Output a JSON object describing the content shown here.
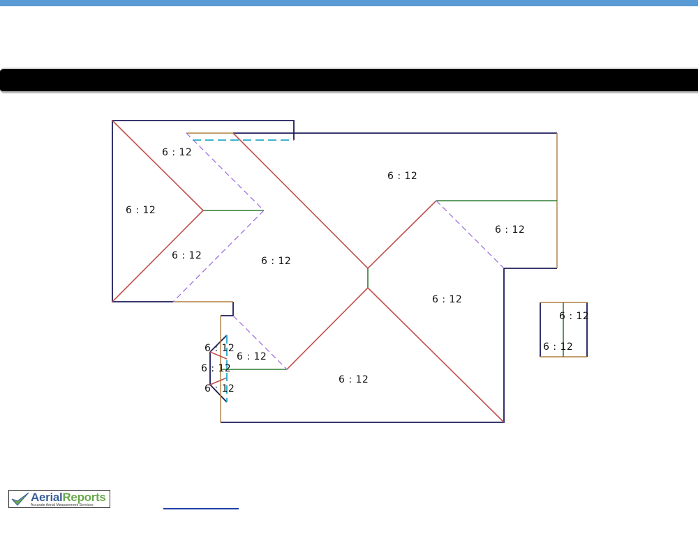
{
  "colors": {
    "top_strip": "#5b9bd5",
    "title_bar": "#000000",
    "eave": "#1c1c5a",
    "rake": "#b08040",
    "hip": "#c0504d",
    "ridge": "#2e7d32",
    "valley": "#9966dd",
    "flashing": "#22aacc"
  },
  "diagram": {
    "pitch_labels": [
      "6 : 12",
      "6 : 12",
      "6 : 12",
      "6 : 12",
      "6 : 12",
      "6 : 12",
      "6 : 12",
      "6 : 12",
      "6 : 12",
      "6 : 12",
      "6 : 12",
      "6 : 12",
      "6 : 12",
      "6 : 12"
    ]
  },
  "logo": {
    "name_part1": "Aerial",
    "name_part2": "Reports",
    "tagline": "Accurate Aerial Measurement Services",
    "icon": "checkmark-icon"
  }
}
